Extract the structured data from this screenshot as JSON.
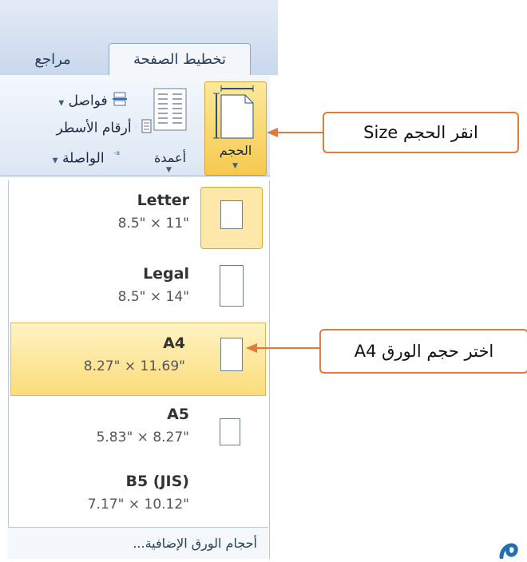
{
  "tabs": {
    "references": "مراجع",
    "page_layout": "تخطيط الصفحة"
  },
  "ribbon": {
    "breaks": "فواصل",
    "line_numbers": "أرقام الأسطر",
    "hyphenation": "الواصلة",
    "columns": "أعمدة",
    "size": "الحجم"
  },
  "sizes": [
    {
      "name": "Letter",
      "dims": "\"11 × \"8.5"
    },
    {
      "name": "Legal",
      "dims": "\"14 × \"8.5"
    },
    {
      "name": "A4",
      "dims": "\"11.69 × \"8.27"
    },
    {
      "name": "A5",
      "dims": "\"8.27 × \"5.83"
    },
    {
      "name": "B5 (JIS)",
      "dims": "\"10.12 × \"7.17"
    }
  ],
  "more_sizes": "أحجام الورق الإضافية...",
  "callouts": {
    "size": "انقر الحجم Size",
    "a4": "اختر حجم الورق A4"
  },
  "colors": {
    "callout_border": "#e07b39",
    "highlight": "#fbdc7a",
    "tab_text": "#2a3e5a"
  },
  "selected_size_index": 2
}
